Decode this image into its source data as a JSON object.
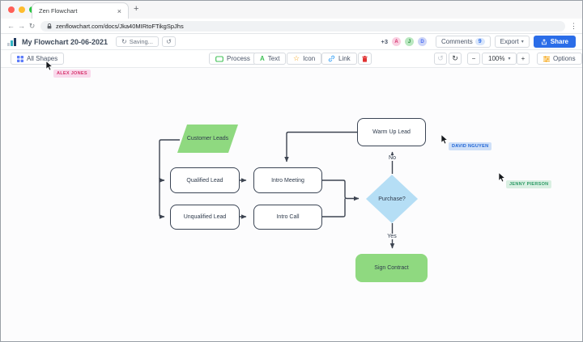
{
  "browser": {
    "tab_title": "Zen Flowchart",
    "url": "zenflowchart.com/docs/Jka40MIRtoFTikgSpJhs"
  },
  "header": {
    "title": "My Flowchart 20-06-2021",
    "saving_label": "Saving...",
    "overflow_count": "+3",
    "avatars": [
      {
        "initial": "A"
      },
      {
        "initial": "J"
      },
      {
        "initial": "D"
      }
    ],
    "comments_label": "Comments",
    "comments_count": "9",
    "export_label": "Export",
    "share_label": "Share"
  },
  "toolbar": {
    "all_shapes": "All Shapes",
    "process": "Process",
    "text": "Text",
    "icon": "Icon",
    "link": "Link",
    "zoom_level": "100%",
    "minus": "−",
    "plus": "+",
    "options": "Options"
  },
  "icons": {
    "close": "×",
    "new_tab": "+",
    "back": "←",
    "forward": "→",
    "reload": "↻",
    "menu": "⋮",
    "saving": "↻",
    "history": "↺",
    "text_glyph": "A",
    "star": "☆",
    "undo": "↺",
    "redo": "↻",
    "caret": "▾"
  },
  "collaborators": [
    {
      "name": "ALEX JONES"
    },
    {
      "name": "DAVID NGUYEN"
    },
    {
      "name": "JENNY PIERSON"
    }
  ],
  "flowchart": {
    "nodes": [
      {
        "label": "Customer Leads",
        "type": "input"
      },
      {
        "label": "Qualified Lead",
        "type": "process"
      },
      {
        "label": "Intro Meeting",
        "type": "process"
      },
      {
        "label": "Unqualified Lead",
        "type": "process"
      },
      {
        "label": "Intro Call",
        "type": "process"
      },
      {
        "label": "Warm Up Lead",
        "type": "process"
      },
      {
        "label": "Purchase?",
        "type": "decision"
      },
      {
        "label": "Sign Contract",
        "type": "end"
      }
    ],
    "edge_labels": {
      "no": "No",
      "yes": "Yes"
    },
    "colors": {
      "node_green": "#8fd980",
      "decision_blue": "#b5def5",
      "connector": "#3d4451"
    }
  }
}
